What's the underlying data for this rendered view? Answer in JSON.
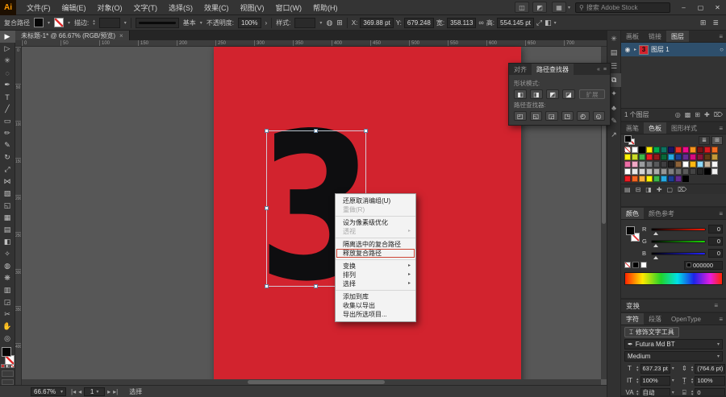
{
  "titlebar": {
    "logo": "Ai",
    "menus": [
      {
        "label": "文件(F)"
      },
      {
        "label": "编辑(E)"
      },
      {
        "label": "对象(O)"
      },
      {
        "label": "文字(T)"
      },
      {
        "label": "选择(S)"
      },
      {
        "label": "效果(C)"
      },
      {
        "label": "视图(V)"
      },
      {
        "label": "窗口(W)"
      },
      {
        "label": "帮助(H)"
      }
    ],
    "doc_icons": [
      {
        "glyph": "◫",
        "name": "arrange-documents-icon"
      },
      {
        "glyph": "◩",
        "name": "document-layout-icon"
      }
    ],
    "workspace_icon": "▦",
    "search_icon": "⚲",
    "search_label": "搜索 Adobe Stock",
    "minimize": "–",
    "maximize": "▢",
    "close": "✕"
  },
  "options": {
    "context_label": "复合路径",
    "stroke_label": "描边:",
    "brush_name": "基本",
    "opacity_label": "不透明度:",
    "opacity_value": "100%",
    "opacity_more": "›",
    "style_label": "样式:",
    "globe_icon": "◍",
    "grid_icon": "⊞",
    "x_label": "X:",
    "x_value": "369.88 pt",
    "y_label": "Y:",
    "y_value": "679.248",
    "w_label": "宽:",
    "w_value": "358.113",
    "link_icon": "∞",
    "h_label": "高:",
    "h_value": "554.145 pt",
    "transform_icon": "⤢",
    "align_icon": "◧",
    "panels_icon": "⊞",
    "list_icon": "≣"
  },
  "doc_tab": {
    "title": "未标题-1* @ 66.67% (RGB/预览)",
    "close": "×"
  },
  "tools": [
    {
      "glyph": "▶",
      "name": "selection-tool",
      "cls": "active"
    },
    {
      "glyph": "▷",
      "name": "direct-selection-tool",
      "cls": ""
    },
    {
      "glyph": "✳",
      "name": "magic-wand-tool",
      "cls": ""
    },
    {
      "glyph": "◌",
      "name": "lasso-tool",
      "cls": ""
    },
    {
      "glyph": "✒",
      "name": "pen-tool",
      "cls": ""
    },
    {
      "glyph": "T",
      "name": "type-tool",
      "cls": ""
    },
    {
      "glyph": "╱",
      "name": "line-segment-tool",
      "cls": ""
    },
    {
      "glyph": "▭",
      "name": "rectangle-tool",
      "cls": ""
    },
    {
      "glyph": "✏",
      "name": "paintbrush-tool",
      "cls": ""
    },
    {
      "glyph": "✎",
      "name": "pencil-tool",
      "cls": ""
    },
    {
      "glyph": "↻",
      "name": "rotate-tool",
      "cls": ""
    },
    {
      "glyph": "⤢",
      "name": "scale-tool",
      "cls": ""
    },
    {
      "glyph": "⋈",
      "name": "width-tool",
      "cls": ""
    },
    {
      "glyph": "▧",
      "name": "free-transform-tool",
      "cls": ""
    },
    {
      "glyph": "◱",
      "name": "shape-builder-tool",
      "cls": ""
    },
    {
      "glyph": "▦",
      "name": "perspective-grid-tool",
      "cls": ""
    },
    {
      "glyph": "▤",
      "name": "mesh-tool",
      "cls": ""
    },
    {
      "glyph": "◧",
      "name": "gradient-tool",
      "cls": ""
    },
    {
      "glyph": "✧",
      "name": "eyedropper-tool",
      "cls": ""
    },
    {
      "glyph": "◍",
      "name": "blend-tool",
      "cls": ""
    },
    {
      "glyph": "❋",
      "name": "symbol-sprayer-tool",
      "cls": ""
    },
    {
      "glyph": "▥",
      "name": "column-graph-tool",
      "cls": ""
    },
    {
      "glyph": "◲",
      "name": "artboard-tool",
      "cls": ""
    },
    {
      "glyph": "✂",
      "name": "slice-tool",
      "cls": ""
    },
    {
      "glyph": "✋",
      "name": "hand-tool",
      "cls": ""
    },
    {
      "glyph": "◎",
      "name": "zoom-tool",
      "cls": ""
    }
  ],
  "canvas": {
    "digit": "3",
    "artboard_color": "#d2232e",
    "ruler_top": [
      "0",
      "50",
      "100",
      "150",
      "200",
      "250",
      "300",
      "350",
      "400",
      "450",
      "500",
      "550",
      "600",
      "650",
      "700"
    ],
    "ruler_left": [
      "0",
      "50",
      "100",
      "150",
      "200",
      "250",
      "300",
      "350",
      "400"
    ]
  },
  "context_menu": {
    "items": [
      {
        "label": "还原取消编组(U)",
        "cls": "",
        "arrow": ""
      },
      {
        "label": "重做(R)",
        "cls": "disabled",
        "arrow": ""
      },
      {
        "label": "",
        "cls": "sep",
        "arrow": ""
      },
      {
        "label": "设为像素级优化",
        "cls": "",
        "arrow": ""
      },
      {
        "label": "透视",
        "cls": "disabled",
        "arrow": "▸"
      },
      {
        "label": "",
        "cls": "sep",
        "arrow": ""
      },
      {
        "label": "隔离选中的复合路径",
        "cls": "",
        "arrow": ""
      },
      {
        "label": "释放复合路径",
        "cls": "hl",
        "arrow": ""
      },
      {
        "label": "",
        "cls": "sep",
        "arrow": ""
      },
      {
        "label": "变换",
        "cls": "",
        "arrow": "▸"
      },
      {
        "label": "排列",
        "cls": "",
        "arrow": "▸"
      },
      {
        "label": "选择",
        "cls": "",
        "arrow": "▸"
      },
      {
        "label": "",
        "cls": "sep",
        "arrow": ""
      },
      {
        "label": "添加到库",
        "cls": "",
        "arrow": ""
      },
      {
        "label": "收集以导出",
        "cls": "",
        "arrow": ""
      },
      {
        "label": "导出所选项目...",
        "cls": "",
        "arrow": ""
      }
    ]
  },
  "pathfinder": {
    "tab_align": "对齐",
    "tab_pathfinder": "路径查找器",
    "collapse_icon": "«",
    "menu_icon": "≡",
    "shape_modes_label": "形状模式:",
    "shape_modes": [
      {
        "glyph": "◧",
        "name": "unite-button"
      },
      {
        "glyph": "◨",
        "name": "minus-front-button"
      },
      {
        "glyph": "◩",
        "name": "intersect-button"
      },
      {
        "glyph": "◪",
        "name": "exclude-button"
      }
    ],
    "expand_label": "扩展",
    "pathfinders_label": "路径查找器:",
    "pathfinder_buttons": [
      {
        "glyph": "◰",
        "name": "divide-button"
      },
      {
        "glyph": "◱",
        "name": "trim-button"
      },
      {
        "glyph": "◲",
        "name": "merge-button"
      },
      {
        "glyph": "◳",
        "name": "crop-button"
      },
      {
        "glyph": "◴",
        "name": "outline-button"
      },
      {
        "glyph": "◵",
        "name": "minus-back-button"
      }
    ]
  },
  "dock_icons": [
    {
      "glyph": "✳",
      "name": "dock-panel-icon",
      "cls": ""
    },
    {
      "glyph": "▤",
      "name": "dock-panel-icon",
      "cls": ""
    },
    {
      "glyph": "☰",
      "name": "dock-panel-icon",
      "cls": ""
    },
    {
      "glyph": "⧉",
      "name": "dock-panel-icon",
      "cls": "active"
    },
    {
      "glyph": "✦",
      "name": "dock-panel-icon",
      "cls": ""
    },
    {
      "glyph": "♣",
      "name": "dock-panel-icon",
      "cls": ""
    },
    {
      "glyph": "✎",
      "name": "dock-panel-icon",
      "cls": ""
    },
    {
      "glyph": "↗",
      "name": "dock-panel-icon",
      "cls": ""
    }
  ],
  "layers_panel": {
    "tabs": [
      {
        "label": "画板",
        "cls": ""
      },
      {
        "label": "链接",
        "cls": ""
      },
      {
        "label": "图层",
        "cls": "active"
      }
    ],
    "menu_icon": "≡",
    "layer_row": {
      "eye": "◉",
      "expander": "▸",
      "thumb_digit": "3",
      "name": "图层 1",
      "target": "○"
    },
    "count_text": "1 个图层",
    "footer_icons": [
      {
        "glyph": "◎",
        "name": "locate-object-icon"
      },
      {
        "glyph": "▩",
        "name": "clipping-mask-icon"
      },
      {
        "glyph": "⊞",
        "name": "new-sublayer-icon"
      },
      {
        "glyph": "✚",
        "name": "new-layer-icon"
      },
      {
        "glyph": "⌦",
        "name": "delete-layer-icon"
      }
    ]
  },
  "swatches_panel": {
    "tabs": [
      {
        "label": "画笔",
        "cls": ""
      },
      {
        "label": "色板",
        "cls": "active"
      },
      {
        "label": "图形样式",
        "cls": ""
      }
    ],
    "menu_icon": "≡",
    "list_icon": "≣",
    "grid_icon": "⊞",
    "swatches": [
      "none",
      "#ffffff",
      "#000000",
      "#ffe800",
      "#00a94f",
      "#0d7361",
      "#1b1464",
      "#e63226",
      "#ec0c8c",
      "#f7941e",
      "#7a1315",
      "#d71a21",
      "#f36d21",
      "#fff20a",
      "#cadb2a",
      "#3cb54b",
      "#ec1c24",
      "#93191c",
      "#0a6838",
      "#27a9e1",
      "#1c3f94",
      "#652c90",
      "#d50b7f",
      "#891538",
      "#603a13",
      "#c49a3a",
      "#ec6ea5",
      "#f1a8c5",
      "#9b9da0",
      "#7a7c7f",
      "#58595b",
      "#3f3e40",
      "#232021",
      "#8c6239",
      "#ffffff",
      "#fdb913",
      "#8ed8f8",
      "#c7b299",
      "#f6f6f6",
      "#ffffff",
      "#e8e8e8",
      "#d4d4d4",
      "#c0c0c0",
      "#ababab",
      "#959595",
      "#818181",
      "#6e6e6e",
      "#5a5a5a",
      "#434343",
      "#262626",
      "#000000",
      "#f3f3f3",
      "#ed1c24",
      "#f26522",
      "#fbb03b",
      "#fff200",
      "#3cb54b",
      "#27a9e1",
      "#1c3f94",
      "#652c90",
      "#000000"
    ],
    "footer_icons": [
      {
        "glyph": "▤",
        "name": "swatch-libraries-icon"
      },
      {
        "glyph": "⊟",
        "name": "color-themes-icon"
      },
      {
        "glyph": "◨",
        "name": "swatch-kinds-icon"
      },
      {
        "glyph": "✚",
        "name": "new-color-group-icon"
      },
      {
        "glyph": "▢",
        "name": "new-swatch-icon"
      },
      {
        "glyph": "⌦",
        "name": "delete-swatch-icon"
      }
    ]
  },
  "color_panel": {
    "tabs": [
      {
        "label": "颜色",
        "cls": "active"
      },
      {
        "label": "颜色参考",
        "cls": ""
      }
    ],
    "menu_icon": "≡",
    "sliders": [
      {
        "label": "R",
        "value": "0",
        "grad": "linear-gradient(to right,#000000,#ff1a00)"
      },
      {
        "label": "G",
        "value": "0",
        "grad": "linear-gradient(to right,#000000,#1ad500)"
      },
      {
        "label": "B",
        "value": "0",
        "grad": "linear-gradient(to right,#000000,#2222ff)"
      }
    ],
    "hex_value": "000000"
  },
  "transform_bar": {
    "label": "变换",
    "menu_icon": "≡"
  },
  "character_panel": {
    "tabs": [
      {
        "label": "字符",
        "cls": "active"
      },
      {
        "label": "段落",
        "cls": ""
      },
      {
        "label": "OpenType",
        "cls": ""
      }
    ],
    "menu_icon": "≡",
    "touch_icon": "⌶",
    "touch_label": "修饰文字工具",
    "font_icon": "✒",
    "font_name": "Futura Md BT",
    "style_name": "Medium",
    "fields": [
      {
        "icon": "T",
        "value": "637.23 pt",
        "name": "font-size-field"
      },
      {
        "icon": "⇕",
        "value": "(764.6 pt)",
        "name": "leading-field"
      },
      {
        "icon": "IT",
        "value": "100%",
        "name": "horizontal-scale-field"
      },
      {
        "icon": "Ṯ",
        "value": "100%",
        "name": "vertical-scale-field"
      },
      {
        "icon": "VA",
        "value": "自动",
        "name": "kerning-field"
      },
      {
        "icon": "⌸",
        "value": "0",
        "name": "tracking-field"
      }
    ]
  },
  "statusbar": {
    "zoom_value": "66.67%",
    "nav_first": "|◂",
    "nav_prev": "◂",
    "artboard_num": "1",
    "nav_next": "▸",
    "nav_last": "▸|",
    "tool_name": "选择"
  }
}
